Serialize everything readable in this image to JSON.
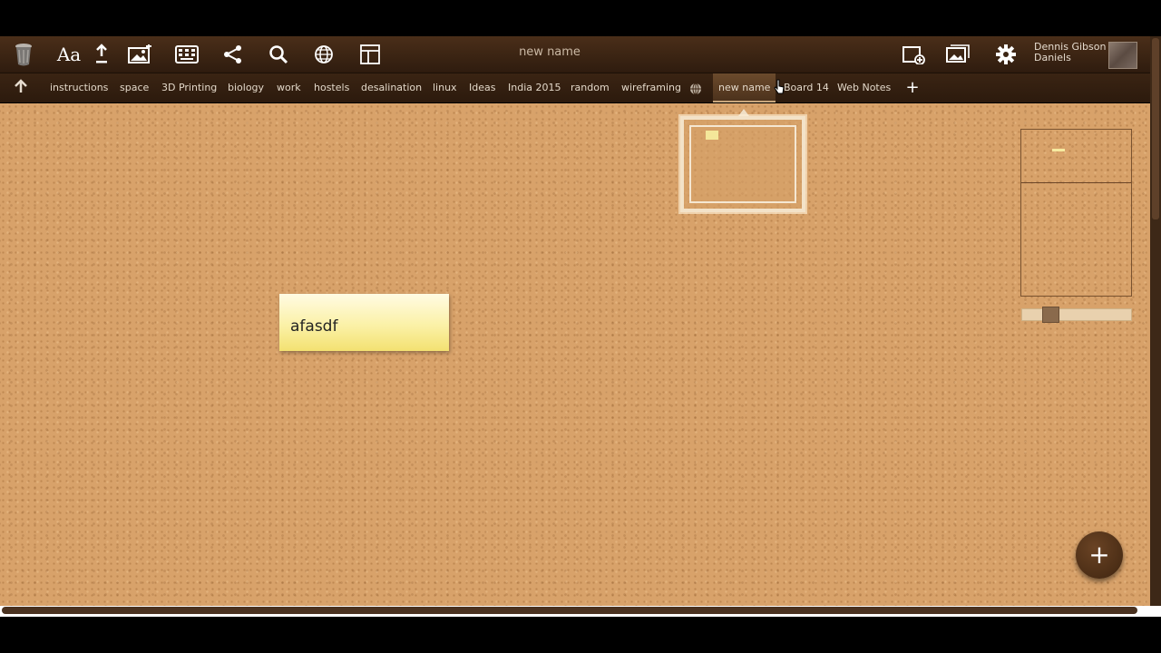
{
  "toolbar": {
    "board_title": "new name",
    "font_label": "Aa",
    "user_name_line1": "Dennis Gibson",
    "user_name_line2": "Daniels",
    "icons": [
      "trash-icon",
      "font-icon",
      "upload-icon",
      "image-icon",
      "keyboard-icon",
      "share-icon",
      "search-icon",
      "globe-icon",
      "layout-icon",
      "new-board-icon",
      "gallery-icon",
      "gear-icon"
    ]
  },
  "tabs": {
    "items": [
      "instructions",
      "space",
      "3D Printing",
      "biology",
      "work",
      "hostels",
      "desalination",
      "linux",
      "Ideas",
      "India 2015",
      "random",
      "wireframing",
      "new name",
      "Board 14",
      "Web Notes"
    ],
    "active": "new name",
    "add_label": "+"
  },
  "board": {
    "note_text": "afasdf",
    "fab_label": "+"
  },
  "minimap": {
    "zoom_fraction": 0.22
  },
  "colors": {
    "toolbar": "#3b2413",
    "cork": "#d8a26a",
    "note": "#fbf1a7",
    "fab": "#4c2e16"
  }
}
